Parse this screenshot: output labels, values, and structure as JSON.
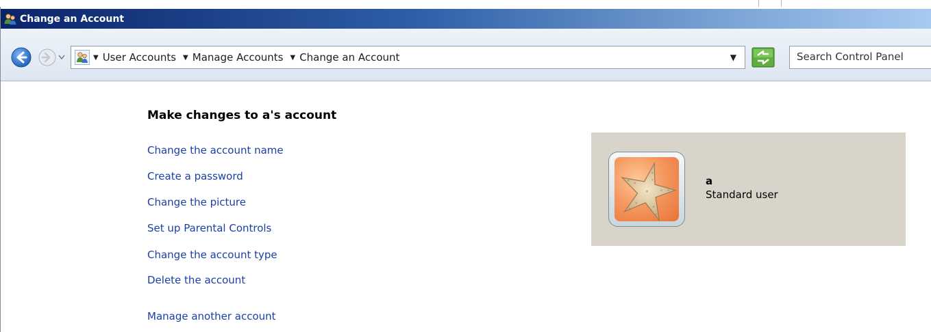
{
  "window": {
    "title": "Change an Account"
  },
  "toolbar": {
    "breadcrumbs": [
      {
        "label": "User Accounts"
      },
      {
        "label": "Manage Accounts"
      },
      {
        "label": "Change an Account"
      }
    ],
    "search_placeholder": "Search Control Panel"
  },
  "main": {
    "heading": "Make changes to a's account",
    "tasks": [
      {
        "label": "Change the account name"
      },
      {
        "label": "Create a password"
      },
      {
        "label": "Change the picture"
      },
      {
        "label": "Set up Parental Controls"
      },
      {
        "label": "Change the account type"
      },
      {
        "label": "Delete the account"
      },
      {
        "label": "Manage another account"
      }
    ]
  },
  "account": {
    "name": "a",
    "type": "Standard user",
    "picture": "starfish-picture"
  },
  "colors": {
    "title_bar": "#0a246a",
    "link": "#1a3fa6",
    "panel_bg": "#d8d4ca"
  }
}
